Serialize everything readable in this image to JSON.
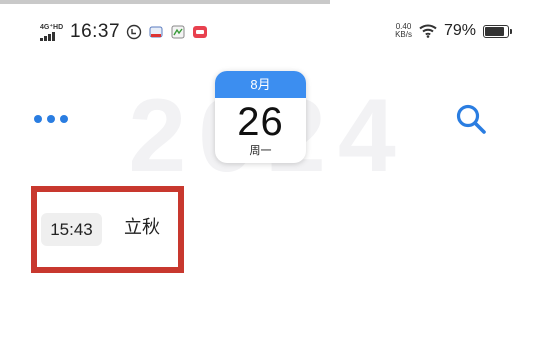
{
  "status_bar": {
    "network_label": "4G⁺HD",
    "time": "16:37",
    "speed_value": "0.40",
    "speed_unit": "KB/s",
    "battery_percent": "79%",
    "battery_level": 0.79,
    "notification_icons": [
      "notification-badge-icon",
      "app-notification-icon",
      "app-notification-icon",
      "app-notification-icon"
    ],
    "wifi_icon": "wifi-icon"
  },
  "header": {
    "year_watermark": "2024",
    "more_icon": "more-dots-icon",
    "search_icon": "search-icon",
    "accent_color": "#2a7de1"
  },
  "calendar_card": {
    "month": "8月",
    "day": "26",
    "weekday": "周一",
    "header_color": "#3c8ef0"
  },
  "event": {
    "time": "15:43",
    "title": "立秋",
    "highlight_color": "#c8382e"
  }
}
